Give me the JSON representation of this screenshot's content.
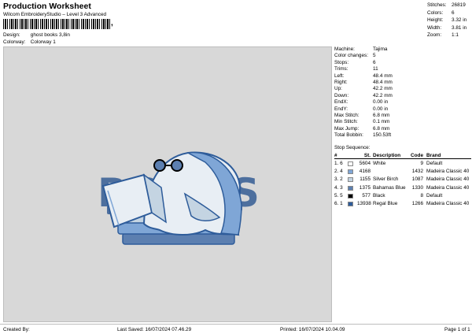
{
  "header": {
    "title": "Production Worksheet",
    "subtitle": "Wilcom EmbroideryStudio – Level 3 Advanced",
    "barcode_suffix": ",",
    "design_label": "Design:",
    "design_value": "ghost books 3,8in",
    "colorway_label": "Colorway:",
    "colorway_value": "Colorway 1"
  },
  "stats": [
    {
      "label": "Stitches:",
      "value": "26819"
    },
    {
      "label": "Colors:",
      "value": "6"
    },
    {
      "label": "Height:",
      "value": "3.32 in"
    },
    {
      "label": "Width:",
      "value": "3.81 in"
    },
    {
      "label": "Zoom:",
      "value": "1:1"
    }
  ],
  "design_image": {
    "word": "BOOKS"
  },
  "machine_info": [
    {
      "label": "Machine:",
      "value": "Tajima"
    },
    {
      "label": "Color changes:",
      "value": "5"
    },
    {
      "label": "Stops:",
      "value": "6"
    },
    {
      "label": "Trims:",
      "value": "11"
    },
    {
      "label": "Left:",
      "value": "48.4 mm"
    },
    {
      "label": "Right:",
      "value": "48.4 mm"
    },
    {
      "label": "Up:",
      "value": "42.2 mm"
    },
    {
      "label": "Down:",
      "value": "42.2 mm"
    },
    {
      "label": "EndX:",
      "value": "0.00 in"
    },
    {
      "label": "EndY:",
      "value": "0.00 in"
    },
    {
      "label": "Max Stitch:",
      "value": "6.8 mm"
    },
    {
      "label": "Min Stitch:",
      "value": "0.1 mm"
    },
    {
      "label": "Max Jump:",
      "value": "6.8 mm"
    },
    {
      "label": "Total Bobbin:",
      "value": "150.53ft"
    }
  ],
  "stop_sequence": {
    "title": "Stop Sequence:",
    "columns": {
      "num": "#",
      "st": "St.",
      "desc": "Description",
      "code": "Code",
      "brand": "Brand"
    },
    "rows": [
      {
        "num": "1.",
        "idx": "6",
        "color": "#ffffff",
        "st": "5604",
        "desc": "White",
        "code": "9",
        "brand": "Default"
      },
      {
        "num": "2.",
        "idx": "4",
        "color": "#7fa6d6",
        "st": "4168",
        "desc": "",
        "code": "1432",
        "brand": "Madeira Classic 40"
      },
      {
        "num": "3.",
        "idx": "2",
        "color": "#c4d4e2",
        "st": "1155",
        "desc": "Silver Birch",
        "code": "1087",
        "brand": "Madeira Classic 40"
      },
      {
        "num": "4.",
        "idx": "3",
        "color": "#5c7fb0",
        "st": "1375",
        "desc": "Bahamas Blue",
        "code": "1330",
        "brand": "Madeira Classic 40"
      },
      {
        "num": "5.",
        "idx": "5",
        "color": "#000000",
        "st": "577",
        "desc": "Black",
        "code": "8",
        "brand": "Default"
      },
      {
        "num": "6.",
        "idx": "1",
        "color": "#2e5c9a",
        "st": "13938",
        "desc": "Regal Blue",
        "code": "1266",
        "brand": "Madeira Classic 40"
      }
    ]
  },
  "footer": {
    "created_by": "Created By:",
    "last_saved": "Last Saved: 16/07/2024 07.46.29",
    "printed": "Printed: 16/07/2024 10.04.09",
    "page": "Page 1 of 1"
  }
}
